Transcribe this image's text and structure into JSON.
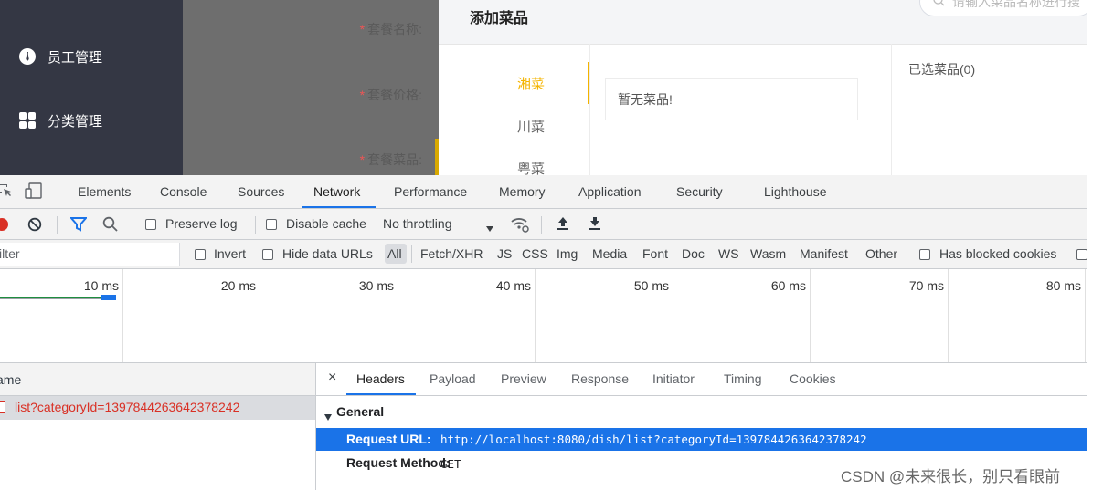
{
  "sidebar": {
    "items": [
      {
        "label": "员工管理",
        "icon": "person-tie-icon"
      },
      {
        "label": "分类管理",
        "icon": "grid-icon"
      }
    ]
  },
  "form": {
    "labels": [
      "套餐名称:",
      "套餐价格:",
      "套餐菜品:"
    ],
    "required_mark": "*"
  },
  "dialog": {
    "title": "添加菜品",
    "search_placeholder": "请输入菜品名称进行搜",
    "categories": [
      {
        "label": "湘菜",
        "active": true
      },
      {
        "label": "川菜",
        "active": false
      },
      {
        "label": "粤菜",
        "active": false
      }
    ],
    "empty_text": "暂无菜品!",
    "selected_label": "已选菜品(0)"
  },
  "devtools": {
    "tabs": [
      "Elements",
      "Console",
      "Sources",
      "Network",
      "Performance",
      "Memory",
      "Application",
      "Security",
      "Lighthouse"
    ],
    "active_tab": "Network",
    "toolbar": {
      "preserve_log": "Preserve log",
      "disable_cache": "Disable cache",
      "throttling": "No throttling"
    },
    "filter": {
      "placeholder": "ilter",
      "invert": "Invert",
      "hide_data_urls": "Hide data URLs",
      "types": [
        "All",
        "Fetch/XHR",
        "JS",
        "CSS",
        "Img",
        "Media",
        "Font",
        "Doc",
        "WS",
        "Wasm",
        "Manifest",
        "Other"
      ],
      "has_blocked_cookies": "Has blocked cookies"
    },
    "timeline_ticks": [
      "10 ms",
      "20 ms",
      "30 ms",
      "40 ms",
      "50 ms",
      "60 ms",
      "70 ms",
      "80 ms"
    ],
    "list": {
      "header": "ame",
      "rows": [
        "list?categoryId=1397844263642378242"
      ]
    },
    "detail": {
      "close": "×",
      "tabs": [
        "Headers",
        "Payload",
        "Preview",
        "Response",
        "Initiator",
        "Timing",
        "Cookies"
      ],
      "active_tab": "Headers",
      "section": "General",
      "request_url_label": "Request URL:",
      "request_url": "http://localhost:8080/dish/list?categoryId=1397844263642378242",
      "request_method_label": "Request Method:",
      "request_method": "GET"
    }
  },
  "watermark": "CSDN @未来很长，别只看眼前"
}
